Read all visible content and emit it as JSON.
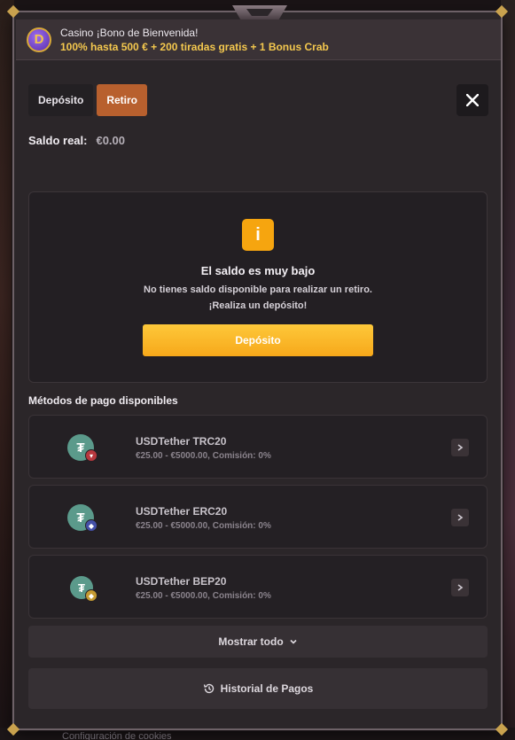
{
  "promo": {
    "icon": "dragon-coin-icon",
    "line1": "Casino ¡Bono de Bienvenida!",
    "line2": "100% hasta 500 € + 200 tiradas gratis + 1 Bonus Crab"
  },
  "tabs": [
    {
      "label": "Depósito",
      "active": false
    },
    {
      "label": "Retiro",
      "active": true
    }
  ],
  "balance": {
    "label": "Saldo real:",
    "value": "€0.00"
  },
  "alert": {
    "icon_text": "i",
    "title": "El saldo es muy bajo",
    "desc_line1": "No tienes saldo disponible para realizar un retiro.",
    "desc_line2": "¡Realiza un depósito!",
    "button_label": "Depósito"
  },
  "methods": {
    "title": "Métodos de pago disponibles",
    "items": [
      {
        "name": "USDTether TRC20",
        "meta": "€25.00 - €5000.00, Comisión: 0%",
        "network_icon": "tron-icon"
      },
      {
        "name": "USDTether ERC20",
        "meta": "€25.00 - €5000.00, Comisión: 0%",
        "network_icon": "ethereum-icon"
      },
      {
        "name": "USDTether BEP20",
        "meta": "€25.00 - €5000.00, Comisión: 0%",
        "network_icon": "bnb-icon"
      }
    ]
  },
  "show_all_label": "Mostrar todo",
  "history_label": "Historial de Pagos",
  "colors": {
    "accent": "#b8602e",
    "deposit_button": "#f7a81a",
    "warning": "#f6a50f",
    "tether": "#5b9a8b"
  },
  "background": {
    "footer_text": "Configuración de cookies"
  }
}
